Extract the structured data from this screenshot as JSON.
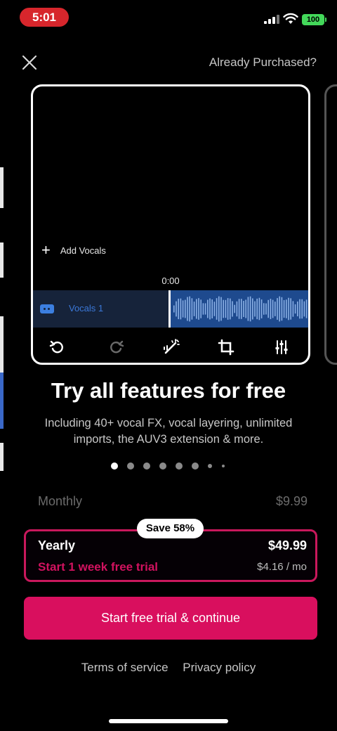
{
  "status_bar": {
    "time": "5:01",
    "battery": "100"
  },
  "header": {
    "close_icon": "close-icon",
    "already_purchased": "Already Purchased?"
  },
  "preview": {
    "add_vocals": "Add Vocals",
    "timecode": "0:00",
    "track_label": "Vocals 1",
    "tools": [
      "undo-icon",
      "redo-icon",
      "magic-wand-icon",
      "crop-icon",
      "mixer-sliders-icon"
    ]
  },
  "headline": "Try all features for free",
  "subheadline": "Including 40+ vocal FX, vocal layering, unlimited imports, the AUV3 extension & more.",
  "pager": {
    "total": 8,
    "active_index": 0
  },
  "plans": {
    "monthly": {
      "name": "Monthly",
      "price": "$9.99"
    },
    "yearly": {
      "name": "Yearly",
      "price": "$49.99",
      "trial": "Start 1 week free trial",
      "per_month": "$4.16 / mo",
      "badge": "Save 58%"
    }
  },
  "cta_label": "Start free trial & continue",
  "footer": {
    "terms": "Terms of service",
    "privacy": "Privacy policy"
  },
  "colors": {
    "accent": "#d90f5e",
    "track_blue": "#3b78d8",
    "battery_green": "#43d85a",
    "time_pill": "#d7262c"
  }
}
